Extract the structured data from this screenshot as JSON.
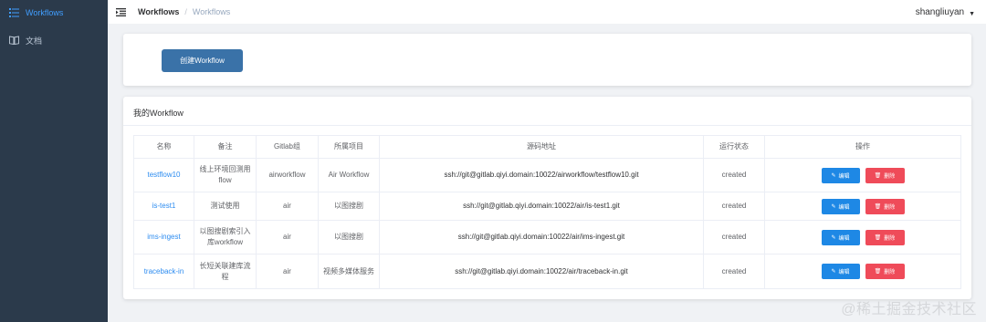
{
  "sidebar": {
    "items": [
      {
        "label": "Workflows",
        "icon": "list-icon",
        "active": true
      },
      {
        "label": "文档",
        "icon": "book-icon",
        "active": false
      }
    ]
  },
  "navbar": {
    "breadcrumb": [
      "Workflows",
      "Workflows"
    ],
    "separator": "/",
    "user": "shangliuyan"
  },
  "create_button": "创建Workflow",
  "list": {
    "title": "我的Workflow",
    "columns": [
      "名称",
      "备注",
      "Gitlab组",
      "所属项目",
      "源码地址",
      "运行状态",
      "操作"
    ],
    "rows": [
      {
        "name": "testflow10",
        "remark": "线上环境回测用flow",
        "group": "airworkflow",
        "project": "Air Workflow",
        "repo": "ssh://git@gitlab.qiyi.domain:10022/airworkflow/testflow10.git",
        "status": "created"
      },
      {
        "name": "is-test1",
        "remark": "测试使用",
        "group": "air",
        "project": "以图搜剧",
        "repo": "ssh://git@gitlab.qiyi.domain:10022/air/is-test1.git",
        "status": "created"
      },
      {
        "name": "ims-ingest",
        "remark": "以图搜剧索引入库workflow",
        "group": "air",
        "project": "以图搜剧",
        "repo": "ssh://git@gitlab.qiyi.domain:10022/air/ims-ingest.git",
        "status": "created"
      },
      {
        "name": "traceback-in",
        "remark": "长短关联建库流程",
        "group": "air",
        "project": "视频多媒体服务",
        "repo": "ssh://git@gitlab.qiyi.domain:10022/air/traceback-in.git",
        "status": "created"
      }
    ],
    "edit_label": "编辑",
    "delete_label": "删除"
  },
  "watermark": "@稀土掘金技术社区",
  "colors": {
    "sidebar": "#2b3a4b",
    "active": "#409eff",
    "primary": "#3a72a8",
    "edit": "#1e88e5",
    "delete": "#ef4b59"
  }
}
